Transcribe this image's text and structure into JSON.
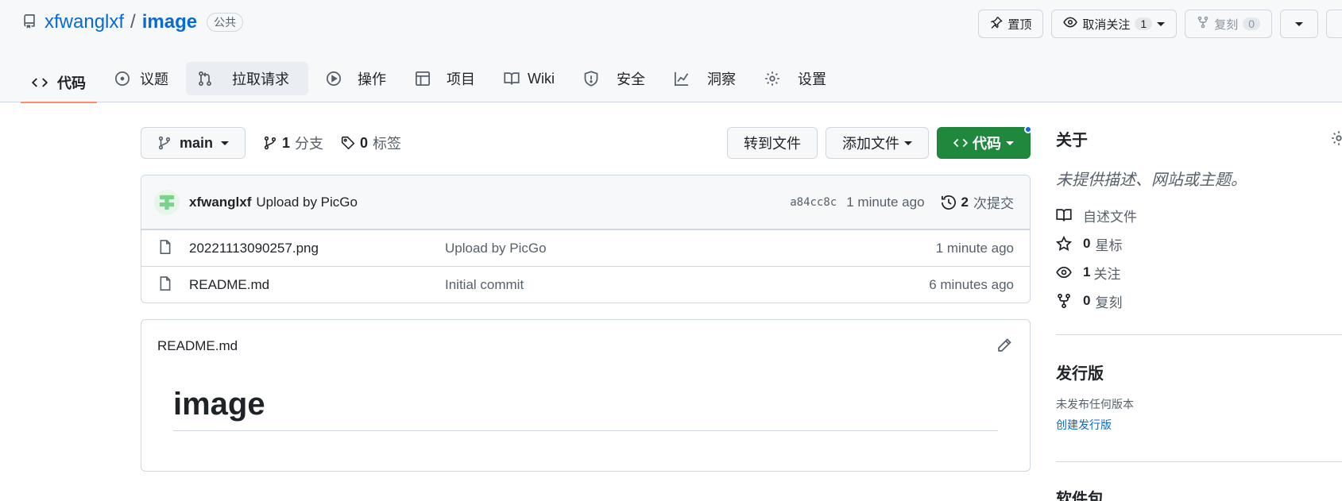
{
  "repo": {
    "owner": "xfwanglxf",
    "separator": "/",
    "name": "image",
    "visibility": "公共"
  },
  "top_actions": {
    "pin_label": "置顶",
    "unwatch_label": "取消关注",
    "watch_count": "1",
    "fork_label": "复刻",
    "fork_count": "0"
  },
  "tabs": [
    {
      "label": "代码",
      "icon": "code-icon"
    },
    {
      "label": "议题",
      "icon": "issue-icon"
    },
    {
      "label": "拉取请求",
      "icon": "pull-request-icon"
    },
    {
      "label": "操作",
      "icon": "play-icon"
    },
    {
      "label": "项目",
      "icon": "table-icon"
    },
    {
      "label": "Wiki",
      "icon": "book-icon"
    },
    {
      "label": "安全",
      "icon": "shield-icon"
    },
    {
      "label": "洞察",
      "icon": "graph-icon"
    },
    {
      "label": "设置",
      "icon": "gear-icon"
    }
  ],
  "branch": {
    "current": "main",
    "branch_count": "1",
    "branch_label": "分支",
    "tag_count": "0",
    "tag_label": "标签"
  },
  "code_buttons": {
    "goto_file": "转到文件",
    "add_file": "添加文件",
    "code": "代码"
  },
  "commit": {
    "author": "xfwanglxf",
    "message": "Upload by PicGo",
    "sha": "a84cc8c",
    "ago": "1 minute ago",
    "commit_count": "2",
    "commit_label": "次提交"
  },
  "files": [
    {
      "name": "20221113090257.png",
      "message": "Upload by PicGo",
      "ago": "1 minute ago"
    },
    {
      "name": "README.md",
      "message": "Initial commit",
      "ago": "6 minutes ago"
    }
  ],
  "readme": {
    "filename": "README.md",
    "heading": "image"
  },
  "about": {
    "title": "关于",
    "description": "未提供描述、网站或主题。",
    "readme_label": "自述文件",
    "stars_count": "0",
    "stars_label": "星标",
    "watching_count": "1",
    "watching_label": "关注",
    "forks_count": "0",
    "forks_label": "复刻"
  },
  "releases": {
    "title": "发行版",
    "none": "未发布任何版本",
    "create_link": "创建发行版"
  },
  "packages": {
    "title": "软件包"
  },
  "colors": {
    "link": "#0969da",
    "green_button": "#1f883d",
    "active_tab_underline": "#fd8c73"
  }
}
